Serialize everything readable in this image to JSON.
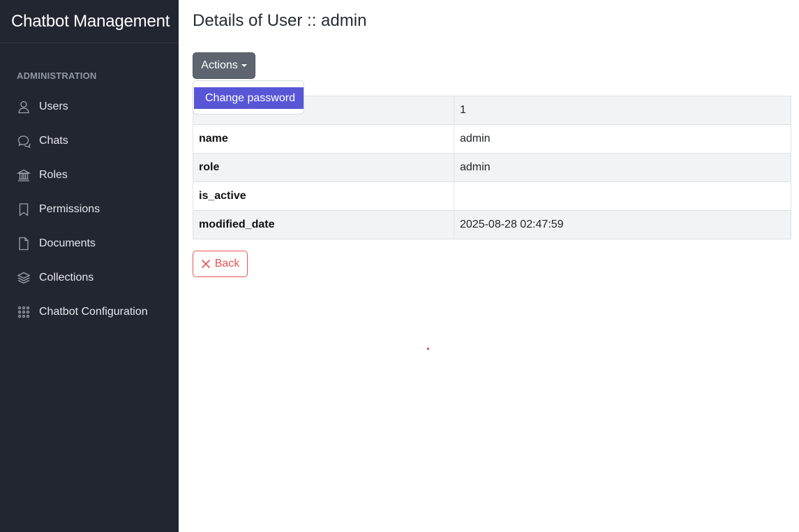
{
  "sidebar": {
    "brand": "Chatbot Management",
    "section_title": "ADMINISTRATION",
    "items": [
      {
        "label": "Users",
        "icon": "user-icon"
      },
      {
        "label": "Chats",
        "icon": "chat-icon"
      },
      {
        "label": "Roles",
        "icon": "bank-icon"
      },
      {
        "label": "Permissions",
        "icon": "bookmark-icon"
      },
      {
        "label": "Documents",
        "icon": "document-icon"
      },
      {
        "label": "Collections",
        "icon": "layers-icon"
      },
      {
        "label": "Chatbot Configuration",
        "icon": "grid-dots-icon"
      }
    ]
  },
  "page": {
    "title": "Details of User :: admin"
  },
  "actions": {
    "label": "Actions",
    "menu_items": [
      "Change password"
    ]
  },
  "details": {
    "rows": [
      {
        "key": "",
        "value": "1"
      },
      {
        "key": "name",
        "value": "admin"
      },
      {
        "key": "role",
        "value": "admin"
      },
      {
        "key": "is_active",
        "value": ""
      },
      {
        "key": "modified_date",
        "value": "2025-08-28 02:47:59"
      }
    ]
  },
  "back": {
    "label": "Back",
    "icon": "close-icon"
  },
  "colors": {
    "sidebar_bg": "#212631",
    "primary": "#5856d6",
    "danger": "#e55353",
    "secondary": "#5e6570"
  }
}
